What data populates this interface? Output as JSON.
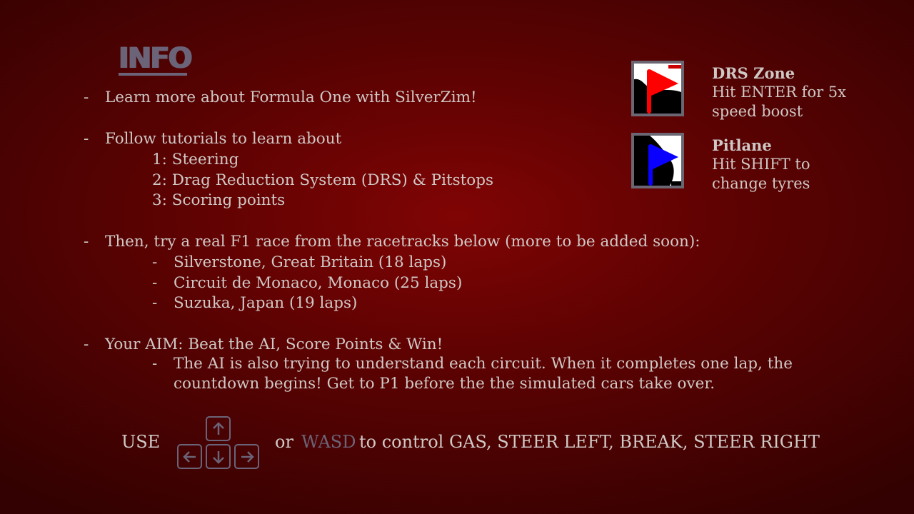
{
  "title": "INFO",
  "intro": "Learn more about Formula One with SilverZim!",
  "tutorials": {
    "heading": "Follow tutorials to learn about",
    "items": [
      "1: Steering",
      "2: Drag Reduction System (DRS) & Pitstops",
      "3: Scoring points"
    ]
  },
  "race": {
    "heading": "Then, try a real F1 race from the racetracks below (more to be added soon):",
    "tracks": [
      "Silverstone, Great Britain (18 laps)",
      "Circuit de Monaco, Monaco (25 laps)",
      "Suzuka, Japan (19 laps)"
    ]
  },
  "aim": {
    "heading": "Your AIM: Beat the AI, Score Points & Win!",
    "detail": "The AI is also trying to understand each circuit. When it completes one lap, the countdown begins! Get to P1 before the the simulated cars take over."
  },
  "dash": "-",
  "legend": [
    {
      "title": "DRS Zone",
      "line1": "Hit ENTER for 5x",
      "line2": "speed boost",
      "icon": "red-flag-icon",
      "color": "#ff0000"
    },
    {
      "title": "Pitlane",
      "line1": "Hit SHIFT to",
      "line2": "change tyres",
      "icon": "blue-flag-icon",
      "color": "#0a00ff"
    }
  ],
  "controls": {
    "use": "USE",
    "or": "or",
    "wasd": "WASD",
    "description": "to control GAS, STEER LEFT, BREAK, STEER RIGHT",
    "keys": [
      "↑",
      "←",
      "↓",
      "→"
    ]
  }
}
